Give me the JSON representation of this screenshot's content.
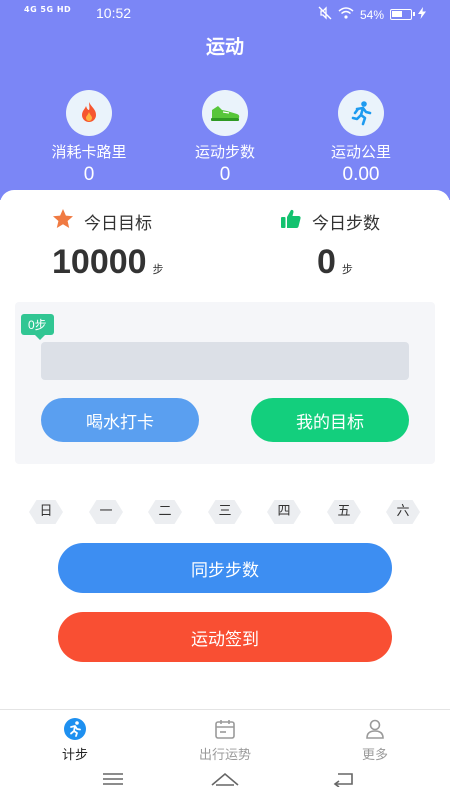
{
  "status_bar": {
    "network": "4G 5G HD",
    "time": "10:52",
    "battery": "54%"
  },
  "header": {
    "title": "运动"
  },
  "stats": [
    {
      "icon": "fire-icon",
      "label": "消耗卡路里",
      "value": "0"
    },
    {
      "icon": "sneaker-icon",
      "label": "运动步数",
      "value": "0"
    },
    {
      "icon": "runner-icon",
      "label": "运动公里",
      "value": "0.00"
    }
  ],
  "goals": {
    "target": {
      "icon": "star-icon",
      "title": "今日目标",
      "value": "10000",
      "unit": "步"
    },
    "today": {
      "icon": "thumbs-up-icon",
      "title": "今日步数",
      "value": "0",
      "unit": "步"
    }
  },
  "progress": {
    "bubble": "0步",
    "fraction": 0
  },
  "buttons": {
    "water": "喝水打卡",
    "goal": "我的目标",
    "sync": "同步步数",
    "sign": "运动签到"
  },
  "week_days": [
    "日",
    "一",
    "二",
    "三",
    "四",
    "五",
    "六"
  ],
  "tabs": [
    {
      "label": "计步",
      "icon": "runner-icon",
      "active": true
    },
    {
      "label": "出行运势",
      "icon": "calendar-icon",
      "active": false
    },
    {
      "label": "更多",
      "icon": "person-icon",
      "active": false
    }
  ],
  "colors": {
    "header": "#7b86f6",
    "accent_green": "#13cf7d",
    "accent_blue": "#3d8ef2",
    "accent_red": "#f94f33"
  }
}
